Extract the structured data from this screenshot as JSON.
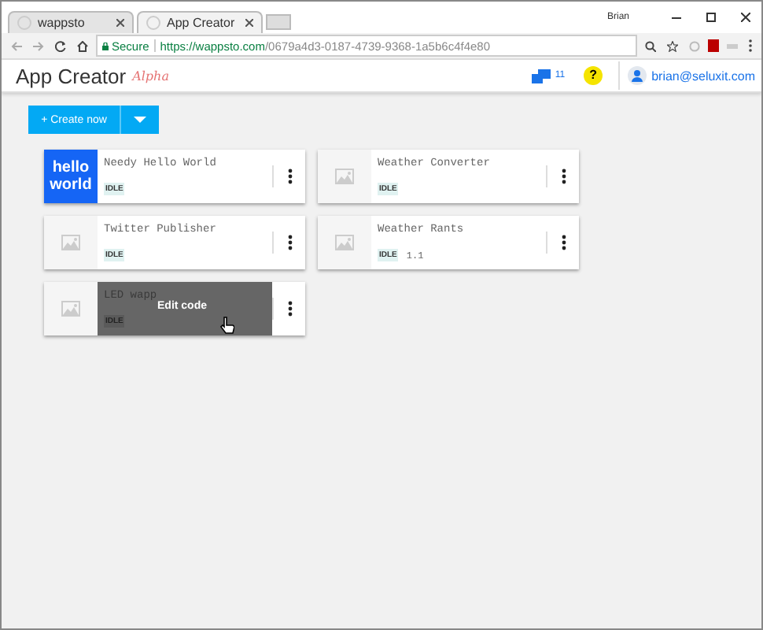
{
  "browser": {
    "user": "Brian",
    "tabs": [
      {
        "title": "wappsto",
        "selected": false
      },
      {
        "title": "App Creator",
        "selected": true
      }
    ],
    "secure_label": "Secure",
    "url_host": "https://wappsto.com",
    "url_path": "/0679a4d3-0187-4739-9368-1a5b6c4f4e80"
  },
  "header": {
    "title": "App Creator",
    "badge": "Alpha",
    "notification_count": "11",
    "help": "?",
    "user": "brian@seluxit.com"
  },
  "create_button": "+ Create now",
  "apps": [
    {
      "name": "Needy Hello World",
      "status": "IDLE",
      "thumbnail": {
        "kind": "logo",
        "lines": [
          "hello",
          "world"
        ]
      },
      "hovered": false
    },
    {
      "name": "Weather Converter",
      "status": "IDLE",
      "thumbnail": {
        "kind": "placeholder"
      },
      "hovered": false
    },
    {
      "name": "Twitter Publisher",
      "status": "IDLE",
      "thumbnail": {
        "kind": "placeholder"
      },
      "hovered": false
    },
    {
      "name": "Weather Rants",
      "status": "IDLE",
      "version": "1.1",
      "thumbnail": {
        "kind": "placeholder"
      },
      "hovered": false
    },
    {
      "name": "LED wapp",
      "status": "IDLE",
      "thumbnail": {
        "kind": "placeholder"
      },
      "hovered": true,
      "hover_action": "Edit code"
    }
  ]
}
